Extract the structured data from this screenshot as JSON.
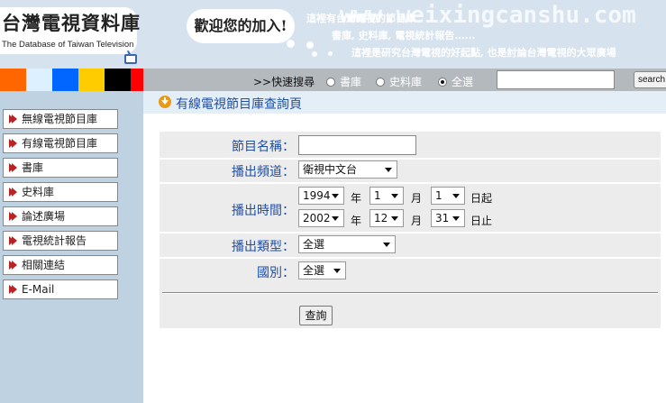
{
  "header": {
    "logo_title": "台灣電視資料庫",
    "logo_subtitle": "The Database of Taiwan Television",
    "welcome": "歡迎您的加入!",
    "intro_line1": "這裡有台灣電視的節目庫",
    "intro_line2": "書庫, 史料庫, 電視統計報告......",
    "intro_line3": "這裡是研究台灣電視的好起點, 也是討論台灣電視的大眾廣場",
    "watermark": "www.weixingcanshu.com",
    "color_strip": [
      "#ff6600",
      "#ddf0ff",
      "#0066ff",
      "#ffcc00",
      "#000000",
      "#ff0000"
    ]
  },
  "search": {
    "prefix": ">>快速搜尋",
    "options": [
      {
        "label": "書庫",
        "checked": false
      },
      {
        "label": "史料庫",
        "checked": false
      },
      {
        "label": "全選",
        "checked": true
      }
    ],
    "input_value": "",
    "button_label": "search"
  },
  "sidebar": {
    "items": [
      {
        "label": "無線電視節目庫"
      },
      {
        "label": "有線電視節目庫"
      },
      {
        "label": "書庫"
      },
      {
        "label": "史料庫"
      },
      {
        "label": "論述廣場"
      },
      {
        "label": "電視統計報告"
      },
      {
        "label": "相關連結"
      },
      {
        "label": "E-Mail"
      }
    ]
  },
  "page": {
    "title": "有線電視節目庫查詢頁"
  },
  "form": {
    "name_label": "節目名稱：",
    "name_value": "",
    "channel_label": "播出頻道：",
    "channel_value": "衛視中文台",
    "time_label": "播出時間：",
    "start": {
      "year": "1994",
      "month": "1",
      "day": "1"
    },
    "end": {
      "year": "2002",
      "month": "12",
      "day": "31"
    },
    "year_unit": "年",
    "month_unit": "月",
    "start_suffix": "日起",
    "end_suffix": "日止",
    "type_label": "播出類型：",
    "type_value": "全選",
    "country_label": "國別：",
    "country_value": "全選",
    "submit_label": "查詢"
  }
}
